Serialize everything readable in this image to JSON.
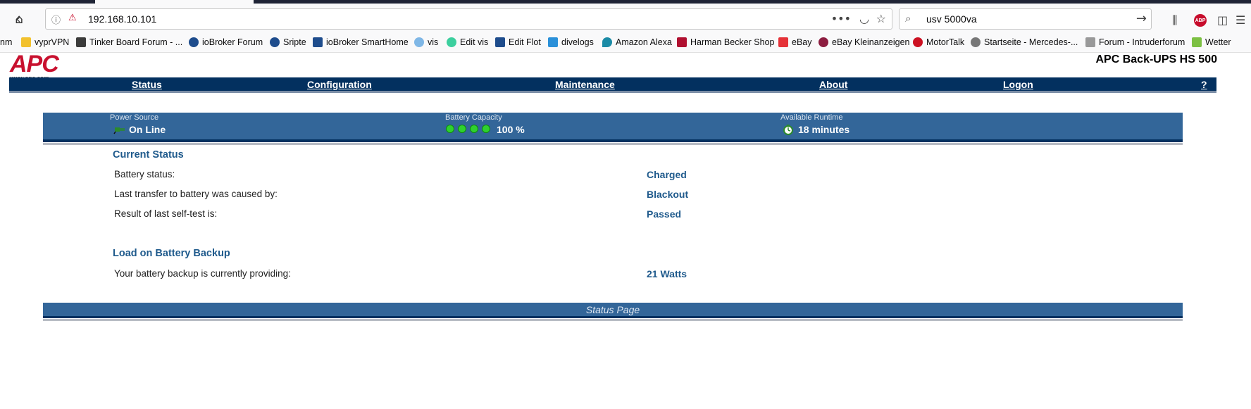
{
  "browser": {
    "url": "192.168.10.101",
    "search_query": "usv 5000va",
    "bookmarks": [
      {
        "label": "nm",
        "icon": "truncated-icon",
        "color": "#ffffff"
      },
      {
        "label": "vyprVPN",
        "icon": "star-icon",
        "color": "#f2c12e"
      },
      {
        "label": "Tinker Board Forum - ...",
        "icon": "forum-icon",
        "color": "#3b3b3b"
      },
      {
        "label": "ioBroker Forum",
        "icon": "iobroker-icon",
        "color": "#1e4c8c"
      },
      {
        "label": "Sripte",
        "icon": "iobroker-icon",
        "color": "#1e4c8c"
      },
      {
        "label": "ioBroker SmartHome",
        "icon": "iobroker-icon",
        "color": "#1e4c8c"
      },
      {
        "label": "vis",
        "icon": "vis-icon",
        "color": "#7fb7e6"
      },
      {
        "label": "Edit vis",
        "icon": "vis-edit-icon",
        "color": "#3ccf9e"
      },
      {
        "label": "Edit Flot",
        "icon": "flot-icon",
        "color": "#1e4c8c"
      },
      {
        "label": "divelogs",
        "icon": "divelogs-icon",
        "color": "#2a90d9"
      },
      {
        "label": "Amazon Alexa",
        "icon": "alexa-icon",
        "color": "#1b8ba6"
      },
      {
        "label": "Harman Becker Shop",
        "icon": "harman-icon",
        "color": "#b01030"
      },
      {
        "label": "eBay",
        "icon": "ebay-icon",
        "color": "#e53238"
      },
      {
        "label": "eBay Kleinanzeigen",
        "icon": "kleinanzeigen-icon",
        "color": "#8c1d40"
      },
      {
        "label": "MotorTalk",
        "icon": "motortalk-icon",
        "color": "#cc1122"
      },
      {
        "label": "Startseite - Mercedes-...",
        "icon": "mercedes-icon",
        "color": "#777777"
      },
      {
        "label": "Forum - Intruderforum",
        "icon": "intruder-icon",
        "color": "#999999"
      },
      {
        "label": "Wetter",
        "icon": "weather-icon",
        "color": "#7cc043"
      }
    ]
  },
  "header": {
    "logo_text": "APC",
    "logo_url": "www.apc.com",
    "product_name": "APC Back-UPS HS 500"
  },
  "menu": {
    "items": [
      "Status",
      "Configuration",
      "Maintenance",
      "About",
      "Logon"
    ],
    "help": "?"
  },
  "status_band": {
    "power_source_label": "Power Source",
    "power_source_value": "On Line",
    "battery_capacity_label": "Battery Capacity",
    "battery_capacity_value": "100 %",
    "battery_dots": 4,
    "runtime_label": "Available Runtime",
    "runtime_value": "18 minutes"
  },
  "current_status": {
    "title": "Current Status",
    "rows": [
      {
        "label": "Battery status:",
        "value": "Charged"
      },
      {
        "label": "Last transfer to battery was caused by:",
        "value": "Blackout"
      },
      {
        "label": "Result of last self-test is:",
        "value": "Passed"
      }
    ]
  },
  "load": {
    "title": "Load on Battery Backup",
    "rows": [
      {
        "label": "Your battery backup is currently providing:",
        "value": "21 Watts"
      }
    ]
  },
  "footer": {
    "text": "Status Page"
  }
}
